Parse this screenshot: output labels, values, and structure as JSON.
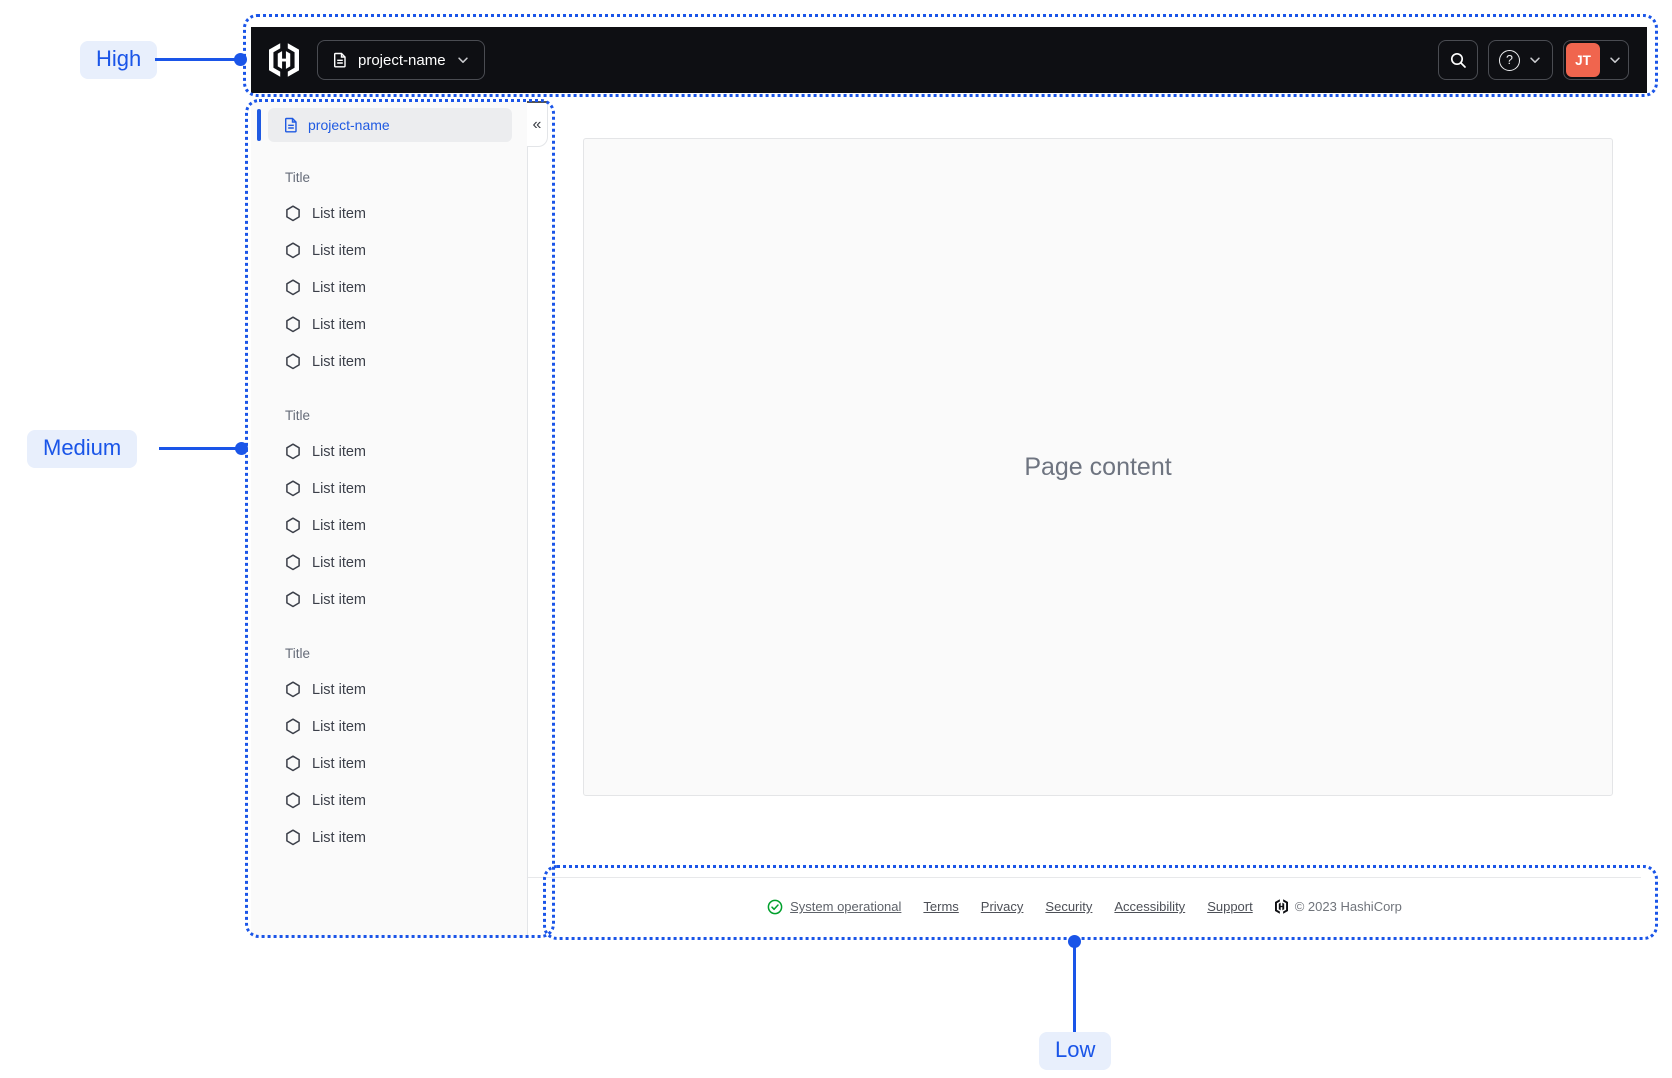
{
  "colors": {
    "annotation_blue": "#1A55E8",
    "annotation_bg": "#E8EFFC",
    "navbar_bg": "#0E0F13",
    "avatar_orange": "#F0654E",
    "link_blue": "#1F5AE2",
    "status_green": "#00A02C",
    "panel_bg": "#FAFAFA",
    "border_gray": "#E3E5E8"
  },
  "annotations": {
    "high": "High",
    "medium": "Medium",
    "low": "Low"
  },
  "navbar": {
    "project_switcher": {
      "label": "project-name"
    },
    "account": {
      "initials": "JT"
    },
    "icons": [
      "hashicorp-logo",
      "file-text-icon",
      "chevron-down-icon",
      "search-icon",
      "help-icon"
    ]
  },
  "sidebar": {
    "header": {
      "label": "project-name"
    },
    "collapse_glyph": "«",
    "sections": [
      {
        "title": "Title",
        "items": [
          "List item",
          "List item",
          "List item",
          "List item",
          "List item"
        ]
      },
      {
        "title": "Title",
        "items": [
          "List item",
          "List item",
          "List item",
          "List item",
          "List item"
        ]
      },
      {
        "title": "Title",
        "items": [
          "List item",
          "List item",
          "List item",
          "List item",
          "List item"
        ]
      }
    ]
  },
  "main": {
    "placeholder": "Page content"
  },
  "footer": {
    "status": "System operational",
    "links": [
      "Terms",
      "Privacy",
      "Security",
      "Accessibility",
      "Support"
    ],
    "copyright": "© 2023 HashiCorp",
    "help_glyph": "?"
  }
}
